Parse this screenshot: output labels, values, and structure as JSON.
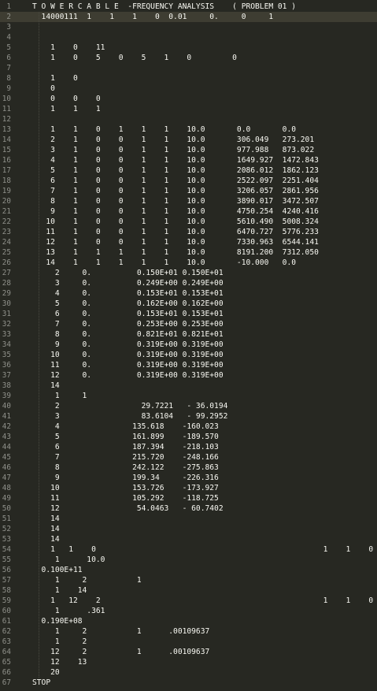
{
  "editor": {
    "theme": {
      "background": "#272822",
      "foreground": "#f8f8f2",
      "gutter_fg": "#8f908a",
      "active_line": "#3e3d32"
    },
    "active_line": 1,
    "lines": [
      "T O W E R C A B L E  -FREQUENCY ANALYSIS    ( PROBLEM 01 )",
      "  14000111  1    1    1    0  0.01     0.     0     1",
      "",
      "",
      "    1    0    11",
      "    1    0    5    0    5    1    0         0",
      "",
      "    1    0",
      "    0",
      "    0    0    0",
      "    1    1    1",
      "",
      "    1    1    0    1    1    1    10.0       0.0       0.0",
      "    2    1    0    0    1    1    10.0       306.049   273.201",
      "    3    1    0    0    1    1    10.0       977.988   873.022",
      "    4    1    0    0    1    1    10.0       1649.927  1472.843",
      "    5    1    0    0    1    1    10.0       2086.012  1862.123",
      "    6    1    0    0    1    1    10.0       2522.097  2251.404",
      "    7    1    0    0    1    1    10.0       3206.057  2861.956",
      "    8    1    0    0    1    1    10.0       3890.017  3472.507",
      "    9    1    0    0    1    1    10.0       4750.254  4240.416",
      "   10    1    0    0    1    1    10.0       5610.490  5008.324",
      "   11    1    0    0    1    1    10.0       6470.727  5776.233",
      "   12    1    0    0    1    1    10.0       7330.963  6544.141",
      "   13    1    1    1    1    1    10.0       8191.200  7312.050",
      "   14    1    1    1    1    1    10.0       -10.000   0.0",
      "     2     0.          0.150E+01 0.150E+01",
      "     3     0.          0.249E+00 0.249E+00",
      "     4     0.          0.153E+01 0.153E+01",
      "     5     0.          0.162E+00 0.162E+00",
      "     6     0.          0.153E+01 0.153E+01",
      "     7     0.          0.253E+00 0.253E+00",
      "     8     0.          0.821E+01 0.821E+01",
      "     9     0.          0.319E+00 0.319E+00",
      "    10     0.          0.319E+00 0.319E+00",
      "    11     0.          0.319E+00 0.319E+00",
      "    12     0.          0.319E+00 0.319E+00",
      "    14",
      "     1     1",
      "     2                  29.7221   - 36.0194",
      "     3                  83.6104   - 99.2952",
      "     4                135.618    -160.023",
      "     5                161.899    -189.570",
      "     6                187.394    -218.103",
      "     7                215.720    -248.166",
      "     8                242.122    -275.863",
      "     9                199.34     -226.316",
      "    10                153.726    -173.927",
      "    11                105.292    -118.725",
      "    12                 54.0463   - 60.7402",
      "    14",
      "    14",
      "    14",
      "    1   1    0                                                  1    1    0",
      "     1      10.0",
      "  0.100E+11",
      "     1     2           1",
      "     1    14",
      "    1   12    2                                                 1    1    0",
      "     1      .361",
      "  0.190E+08",
      "     1     2           1      .00109637",
      "     1     2",
      "    12     2           1      .00109637",
      "    12    13",
      "    20",
      "STOP"
    ]
  }
}
